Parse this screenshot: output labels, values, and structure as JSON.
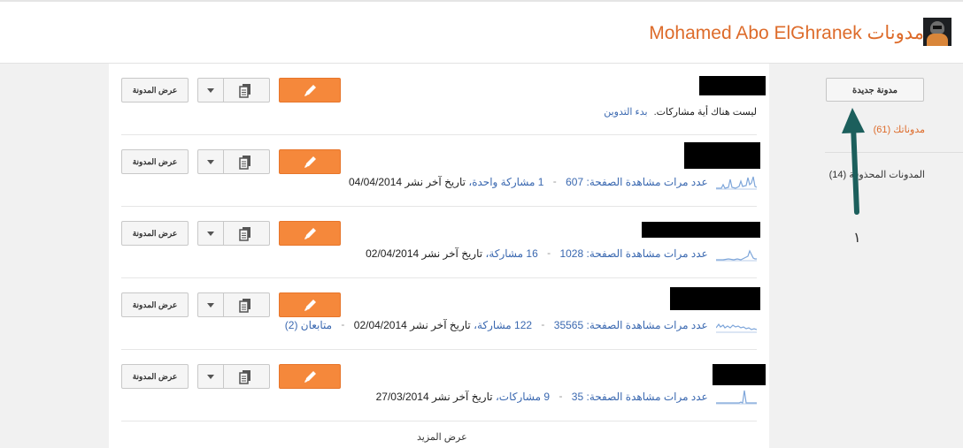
{
  "header": {
    "title": "مدونات Mohamed Abo ElGhranek"
  },
  "sidebar": {
    "new_blog_label": "مدونة جديدة",
    "blogs_count_label": "مدوناتك (61)",
    "deleted_blogs_label": "المدونات المحذوفة (14)",
    "annotation_number": "١"
  },
  "blogs": [
    {
      "view_label": "عرض المدونة",
      "empty": true,
      "empty_text": "ليست هناك أية مشاركات.",
      "start_link": "بدء التدوين"
    },
    {
      "view_label": "عرض المدونة",
      "pageviews_label": "عدد مرات مشاهدة الصفحة:",
      "pageviews": "607",
      "posts_label": "1 مشاركة واحدة،",
      "last_post_label": "تاريخ آخر نشر",
      "last_post_date": "04/04/2014",
      "followers": ""
    },
    {
      "view_label": "عرض المدونة",
      "pageviews_label": "عدد مرات مشاهدة الصفحة:",
      "pageviews": "1028",
      "posts_label": "16 مشاركة،",
      "last_post_label": "تاريخ آخر نشر",
      "last_post_date": "02/04/2014",
      "followers": ""
    },
    {
      "view_label": "عرض المدونة",
      "pageviews_label": "عدد مرات مشاهدة الصفحة:",
      "pageviews": "35565",
      "posts_label": "122 مشاركة،",
      "last_post_label": "تاريخ آخر نشر",
      "last_post_date": "02/04/2014",
      "followers": "متابعان (2)"
    },
    {
      "view_label": "عرض المدونة",
      "pageviews_label": "عدد مرات مشاهدة الصفحة:",
      "pageviews": "35",
      "posts_label": "9 مشاركات،",
      "last_post_label": "تاريخ آخر نشر",
      "last_post_date": "27/03/2014",
      "followers": ""
    }
  ],
  "load_more_label": "عرض المزيد",
  "colors": {
    "accent": "#dd6b2a",
    "edit_button": "#f5883b",
    "link": "#3a68b0",
    "annotation_arrow": "#1c5f5c"
  },
  "icons": {
    "edit": "pencil-icon",
    "posts": "documents-icon",
    "menu": "chevron-down-icon"
  }
}
